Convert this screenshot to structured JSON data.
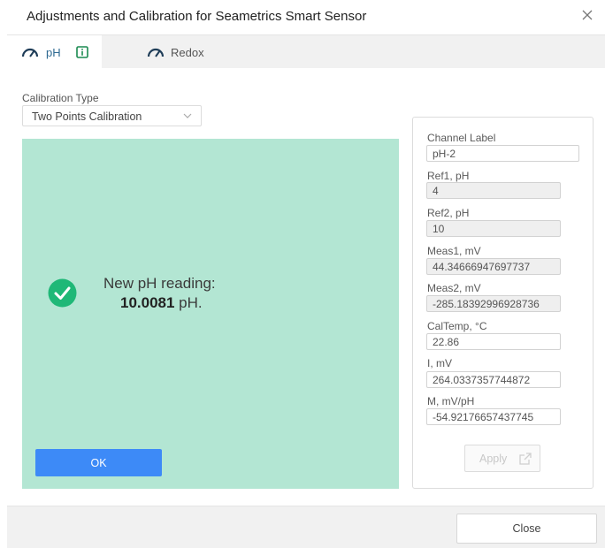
{
  "dialog": {
    "title": "Adjustments and Calibration for Seametrics Smart Sensor",
    "close_icon": "close-icon"
  },
  "tabs": [
    {
      "label": "pH",
      "icon": "gauge-icon",
      "badge_icon": "info-icon",
      "active": true
    },
    {
      "label": "Redox",
      "icon": "gauge-icon",
      "active": false
    }
  ],
  "calibration_type": {
    "label": "Calibration Type",
    "value": "Two Points Calibration"
  },
  "result": {
    "icon": "check-circle-icon",
    "line1": "New pH reading:",
    "value": "10.0081",
    "unit": " pH.",
    "ok_label": "OK"
  },
  "fields": [
    {
      "label": "Channel Label",
      "value": "pH-2",
      "editable": true
    },
    {
      "label": "Ref1, pH",
      "value": "4",
      "editable": false
    },
    {
      "label": "Ref2, pH",
      "value": "10",
      "editable": false
    },
    {
      "label": "Meas1, mV",
      "value": "44.34666947697737",
      "editable": false
    },
    {
      "label": "Meas2, mV",
      "value": "-285.18392996928736",
      "editable": false
    },
    {
      "label": "CalTemp, °C",
      "value": "22.86",
      "editable": false
    },
    {
      "label": "I, mV",
      "value": "264.0337357744872",
      "editable": false
    },
    {
      "label": "M, mV/pH",
      "value": "-54.92176657437745",
      "editable": false
    }
  ],
  "apply": {
    "label": "Apply",
    "icon": "export-icon",
    "disabled": true
  },
  "footer": {
    "close_label": "Close"
  },
  "colors": {
    "accent": "#3d8af7",
    "success_panel": "#b3e6d3",
    "success_check": "#1fb877",
    "tab_active_text": "#2f6a92"
  }
}
